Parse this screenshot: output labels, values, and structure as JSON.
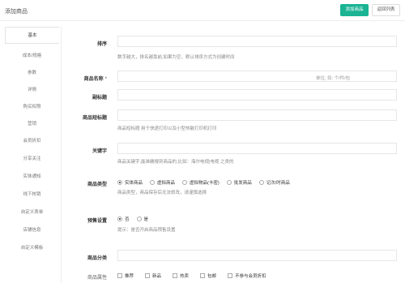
{
  "header": {
    "title": "添加商品",
    "add_button": "添加商品",
    "back_button": "返回列表"
  },
  "sidebar": {
    "items": [
      {
        "label": "基本",
        "active": true
      },
      {
        "label": "成本/规格"
      },
      {
        "label": "参数"
      },
      {
        "label": "详情"
      },
      {
        "label": "购买权限"
      },
      {
        "label": "营销"
      },
      {
        "label": "会员折扣"
      },
      {
        "label": "分享关注"
      },
      {
        "label": "实体通知"
      },
      {
        "label": "线下核销"
      },
      {
        "label": "自定义表单"
      },
      {
        "label": "店铺信息"
      },
      {
        "label": "自定义模板"
      }
    ]
  },
  "form": {
    "sort": {
      "label": "排序",
      "value": "",
      "help": "数字越大，排名越靠前,如果为空，默认排序方式为创建时间"
    },
    "name": {
      "label": "商品名称",
      "required_mark": "*",
      "value": "",
      "unit_hint": "单位, 如: 个/件/包"
    },
    "subtitle": {
      "label": "副标题",
      "value": ""
    },
    "short_title": {
      "label": "商品短标题",
      "value": "",
      "help": "商品短标题 用于快递打印以及小型热敏打印机打印"
    },
    "keywords": {
      "label": "关键字",
      "value": "",
      "help": "商品关键字,能准确搜到商品的,比如：海尔电视|电视 之类的"
    },
    "product_type": {
      "label": "商品类型",
      "options": [
        "实体商品",
        "虚拟商品",
        "虚拟物品(卡密)",
        "批发商品",
        "记次/时商品"
      ],
      "selected": "实体商品",
      "help": "商品类型，商品保存后无法修改，请谨慎选择"
    },
    "presale": {
      "label": "预售设置",
      "options": [
        "否",
        "是"
      ],
      "selected": "否",
      "help": "提示：是否开启商品预售设置"
    },
    "category": {
      "label": "商品分类",
      "value": ""
    },
    "attributes": {
      "label": "商品属性",
      "options": [
        "推荐",
        "新品",
        "热卖",
        "包邮",
        "不参与会员折扣"
      ]
    }
  },
  "colors": {
    "primary": "#1ab394",
    "border": "#e5e6e7",
    "help_text": "#888888"
  }
}
